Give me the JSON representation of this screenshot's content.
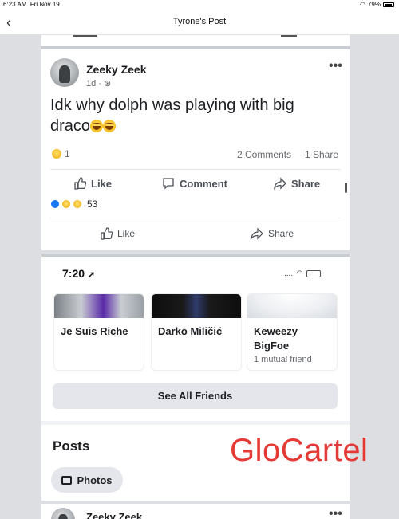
{
  "status_bar": {
    "time": "6:23 AM",
    "date": "Fri Nov 19",
    "battery": "79%"
  },
  "nav": {
    "title": "Tyrone's Post",
    "back_icon": "chevron-left-icon"
  },
  "post": {
    "author": "Zeeky Zeek",
    "meta": "1d · ",
    "text_line1": "Idk why dolph was playing with big",
    "text_line2": "draco",
    "reaction_count": "1",
    "comments": "2 Comments",
    "shares": "1 Share",
    "actions": {
      "like": "Like",
      "comment": "Comment",
      "share": "Share"
    }
  },
  "shared_post": {
    "reaction_count": "53",
    "actions": {
      "like": "Like",
      "share": "Share"
    }
  },
  "phone": {
    "time": "7:20",
    "friends": [
      {
        "name": "Je Suis Riche",
        "sub": ""
      },
      {
        "name": "Darko Miličić",
        "sub": ""
      },
      {
        "name": "Keweezy BigFoe",
        "sub": "1 mutual friend"
      }
    ],
    "see_all": "See All Friends",
    "posts_heading": "Posts",
    "photos_label": "Photos",
    "next_author": "Zeeky Zeek"
  },
  "watermark": "GloCartel",
  "colors": {
    "facebook_blue": "#1877f2",
    "watermark_red": "#e53935"
  }
}
